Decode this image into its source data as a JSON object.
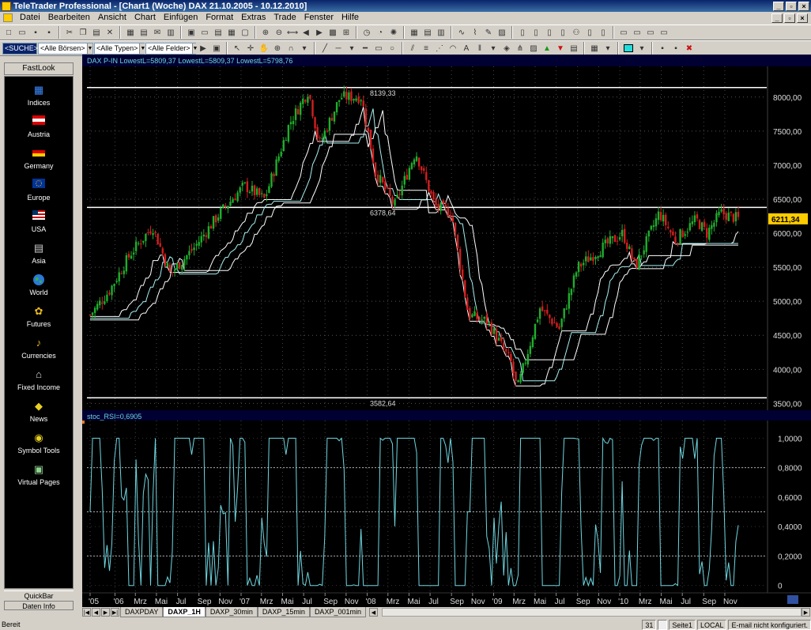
{
  "window": {
    "title": "TeleTrader Professional - [Chart1 (Woche)  DAX 21.10.2005 - 10.12.2010]",
    "buttons": [
      "_",
      "▫",
      "×"
    ]
  },
  "menu": [
    "Datei",
    "Bearbeiten",
    "Ansicht",
    "Chart",
    "Einfügen",
    "Format",
    "Extras",
    "Trade",
    "Fenster",
    "Hilfe"
  ],
  "toolbar2": {
    "search": "<SUCHE>",
    "boersen": "<Alle Börsen>",
    "typen": "<Alle Typen>",
    "felder": "<Alle Felder>"
  },
  "sidebar": {
    "header": "FastLook",
    "items": [
      {
        "label": "Indices",
        "icon": "indices-icon"
      },
      {
        "label": "Austria",
        "icon": "austria-flag-icon"
      },
      {
        "label": "Germany",
        "icon": "germany-flag-icon"
      },
      {
        "label": "Europe",
        "icon": "europe-flag-icon"
      },
      {
        "label": "USA",
        "icon": "usa-flag-icon"
      },
      {
        "label": "Asia",
        "icon": "asia-icon"
      },
      {
        "label": "World",
        "icon": "globe-icon"
      },
      {
        "label": "Futures",
        "icon": "futures-icon"
      },
      {
        "label": "Currencies",
        "icon": "currencies-icon"
      },
      {
        "label": "Fixed Income",
        "icon": "bank-icon"
      },
      {
        "label": "News",
        "icon": "news-icon"
      },
      {
        "label": "Symbol Tools",
        "icon": "symbol-tools-icon"
      },
      {
        "label": "Virtual Pages",
        "icon": "virtual-pages-icon"
      }
    ],
    "quickbar": "QuickBar",
    "dateninfo": "Daten Info"
  },
  "chart_data": [
    {
      "type": "candlestick",
      "legend": "DAX P-IN  LowestL=5809,37 LowestL=5809,37 LowestL=5798,76",
      "y_ticks": [
        "8000,00",
        "7500,00",
        "7000,00",
        "6500,00",
        "6000,00",
        "5500,00",
        "5000,00",
        "4500,00",
        "4000,00",
        "3500,00"
      ],
      "ylim": [
        3400,
        8450
      ],
      "last_price": "6211,34",
      "annotations": [
        {
          "label": "8139,33",
          "value": 8139.33
        },
        {
          "label": "6378,64",
          "value": 6378.64
        },
        {
          "label": "3582,64",
          "value": 3582.64
        }
      ],
      "x_ticks": [
        "'05",
        "'06",
        "Mrz",
        "Mai",
        "Jul",
        "Sep",
        "Nov",
        "'07",
        "Mrz",
        "Mai",
        "Jul",
        "Sep",
        "Nov",
        "'08",
        "Mrz",
        "Mai",
        "Jul",
        "Sep",
        "Nov",
        "'09",
        "Mrz",
        "Mai",
        "Jul",
        "Sep",
        "Nov",
        "'10",
        "Mrz",
        "Mai",
        "Jul",
        "Sep",
        "Nov"
      ],
      "close_path": [
        [
          "2005-10-21",
          4800
        ],
        [
          "2005-12-15",
          5150
        ],
        [
          "2006-02-15",
          5700
        ],
        [
          "2006-04-20",
          6100
        ],
        [
          "2006-06-10",
          5400
        ],
        [
          "2006-08-20",
          5800
        ],
        [
          "2006-11-01",
          6300
        ],
        [
          "2007-01-10",
          6700
        ],
        [
          "2007-03-10",
          6500
        ],
        [
          "2007-05-20",
          7600
        ],
        [
          "2007-07-15",
          8100
        ],
        [
          "2007-08-15",
          7300
        ],
        [
          "2007-10-15",
          8000
        ],
        [
          "2007-12-15",
          8000
        ],
        [
          "2008-01-25",
          6900
        ],
        [
          "2008-03-20",
          6400
        ],
        [
          "2008-05-20",
          7200
        ],
        [
          "2008-07-15",
          6400
        ],
        [
          "2008-09-01",
          6300
        ],
        [
          "2008-10-20",
          4800
        ],
        [
          "2008-12-15",
          4700
        ],
        [
          "2009-02-20",
          4100
        ],
        [
          "2009-03-10",
          3700
        ],
        [
          "2009-05-15",
          4900
        ],
        [
          "2009-07-10",
          4600
        ],
        [
          "2009-09-01",
          5500
        ],
        [
          "2009-11-15",
          5800
        ],
        [
          "2010-01-10",
          6000
        ],
        [
          "2010-02-15",
          5500
        ],
        [
          "2010-04-25",
          6300
        ],
        [
          "2010-06-10",
          5900
        ],
        [
          "2010-08-10",
          6200
        ],
        [
          "2010-09-10",
          6000
        ],
        [
          "2010-10-20",
          6300
        ],
        [
          "2010-12-10",
          6211
        ]
      ]
    },
    {
      "type": "line",
      "legend": "stoc_RSI=0,6905",
      "y_ticks": [
        "1,0000",
        "0,8000",
        "0,6000",
        "0,4000",
        "0,2000",
        "0"
      ],
      "ylim": [
        -0.05,
        1.12
      ],
      "reference_lines": [
        0.2,
        0.5,
        0.8
      ]
    }
  ],
  "tabs": [
    "DAXPDAY",
    "DAXP_1H",
    "DAXP_30min",
    "DAXP_15min",
    "DAXP_001min"
  ],
  "active_tab": "DAXP_1H",
  "status": {
    "left": "Bereit",
    "num": "31",
    "page": "Seite1",
    "mode": "LOCAL",
    "email": "E-mail nicht konfiguriert."
  },
  "colors": {
    "up": "#1fae2e",
    "down": "#d11f1f",
    "stoch_line": "#6fd6e0",
    "band1": "#ffffff",
    "band2": "#a8f0f0",
    "price_box": "#ffcc00"
  }
}
